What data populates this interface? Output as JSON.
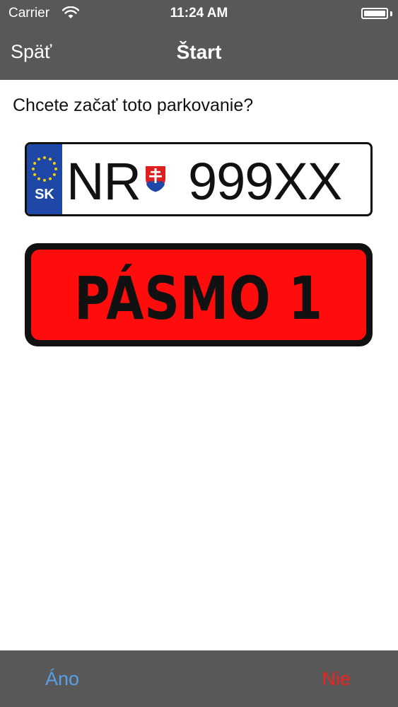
{
  "status_bar": {
    "carrier": "Carrier",
    "time": "11:24 AM"
  },
  "nav": {
    "back_label": "Späť",
    "title": "Štart"
  },
  "question": "Chcete začať toto parkovanie?",
  "plate": {
    "country_code": "SK",
    "region": "NR",
    "number": "999XX"
  },
  "zone": {
    "label": "PÁSMO 1"
  },
  "toolbar": {
    "yes_label": "Áno",
    "no_label": "Nie"
  },
  "colors": {
    "bar_background": "#585858",
    "yes_button": "#5aa0e6",
    "no_button": "#ee2222",
    "zone_red": "#ff0d0d",
    "eu_blue": "#1f47a8"
  },
  "icons": [
    "wifi-icon",
    "battery-icon",
    "eu-stars-icon",
    "slovak-coat-of-arms-icon"
  ]
}
